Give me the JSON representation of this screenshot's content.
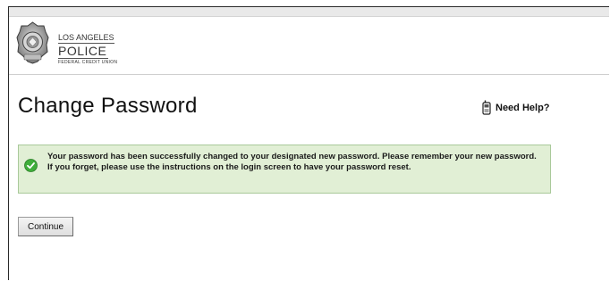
{
  "header": {
    "logo": {
      "line1": "LOS ANGELES",
      "line2": "POLICE",
      "line3": "FEDERAL CREDIT UNION"
    }
  },
  "page": {
    "title": "Change Password",
    "help_label": "Need Help?"
  },
  "message": {
    "status": "success",
    "text": "Your password has been successfully changed to your designated new password. Please remember your new password. If you forget, please use the instructions on the login screen to have your password reset."
  },
  "actions": {
    "continue_label": "Continue"
  },
  "colors": {
    "success_background": "#e1efd5",
    "success_border": "#a9c99a",
    "success_icon": "#3fae3a"
  },
  "icons": {
    "logo": "police-badge-icon",
    "help": "cell-phone-icon",
    "status": "check-circle-icon"
  }
}
